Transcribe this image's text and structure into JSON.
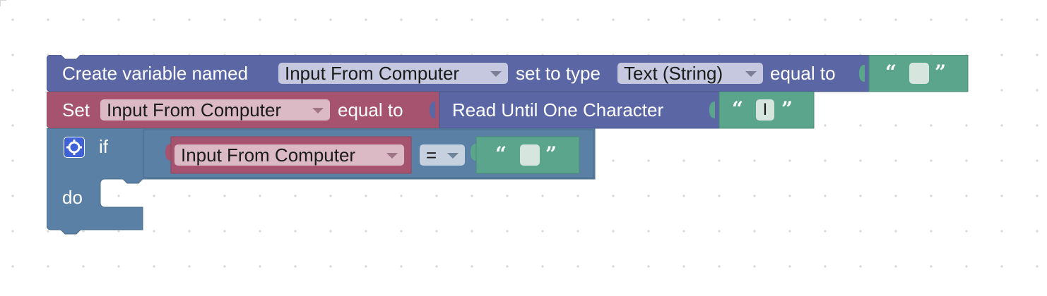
{
  "colors": {
    "variable_block": "#5b67a5",
    "set_block": "#a5536f",
    "if_block": "#5b80a5",
    "text_block": "#5ba58c",
    "dropdown_variable": "#c5c8de",
    "dropdown_pink": "#dbbac6",
    "dropdown_if": "#c5d1de"
  },
  "row1": {
    "label_create": "Create variable named",
    "var_name": "Input From Computer",
    "label_set_type": "set to type",
    "type_value": "Text (String)",
    "label_equal": "equal to",
    "text_open": "“",
    "text_value": "",
    "text_close": "”"
  },
  "row2": {
    "label_set": "Set",
    "var_name": "Input From Computer",
    "label_equal": "equal to",
    "read_label": "Read Until One Character",
    "text_open": "“",
    "text_value": "I",
    "text_close": "”"
  },
  "if_block": {
    "gear_icon": "gear-icon",
    "label_if": "if",
    "label_do": "do",
    "var_name": "Input From Computer",
    "operator": "=",
    "text_open": "“",
    "text_value": "",
    "text_close": "”"
  }
}
